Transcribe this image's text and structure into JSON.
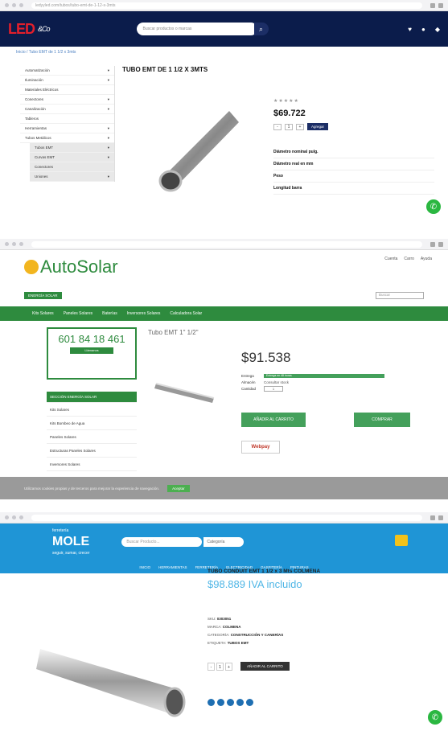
{
  "panel1": {
    "url": "ledyyled.com/tubos/tubo-emt-de-1-12-x-3mts",
    "logo": "LED",
    "logo_sub": "&Co",
    "search_placeholder": "Buscar productos o marcas",
    "breadcrumb": "Inicio / Tubo EMT de 1 1/2 x 3mts",
    "sidebar": [
      "Automatización",
      "Iluminación",
      "Materiales Eléctricos",
      "Conectores",
      "Canalización",
      "Tableros",
      "Herramientas",
      "Tubos Metálicos"
    ],
    "sidebar_sub": [
      "Tubos EMT",
      "Curvas EMT",
      "Conectores",
      "Uniones"
    ],
    "title": "TUBO EMT DE 1 1/2 X 3MTS",
    "stars": "★★★★★",
    "price": "$69.722",
    "add_label": "Agregar",
    "specs": [
      "Diámetro nominal pulg.",
      "Diámetro real en mm",
      "Peso",
      "Longitud barra"
    ]
  },
  "panel2": {
    "logo": "AutoSolar",
    "badge": "ENERGÍA SOLAR",
    "top_links": [
      "Cuenta",
      "Carro",
      "Ayuda"
    ],
    "search_placeholder": "Buscar",
    "nav": [
      "Kits Solares",
      "Paneles Solares",
      "Baterías",
      "Inversores Solares",
      "Calculadora Solar"
    ],
    "phone": "601 84 18 461",
    "phone_button": "Llámanos",
    "menu_head": "SECCIÓN ENERGÍA SOLAR",
    "menu": [
      "Kits Solares",
      "Kits Bombeo de Agua",
      "Paneles Solares",
      "Estructuras Paneles Solares",
      "Inversores Solares"
    ],
    "title": "Tubo EMT 1\" 1/2\"",
    "price": "$91.538",
    "rows": [
      [
        "Entrega",
        "Entrega en 48 horas"
      ],
      [
        "Almacén",
        "Consultar stock"
      ],
      [
        "Cantidad",
        "1"
      ]
    ],
    "buy_button": "AÑADIR AL CARRITO",
    "buy_now": "COMPRAR",
    "webpay": "Webpay",
    "cookie_text": "Utilizamos cookies propias y de terceros para mejorar la experiencia de navegación.",
    "cookie_accept": "Aceptar"
  },
  "panel3": {
    "logo": "MOLE",
    "logo_top": "ferretería",
    "logo_sub": "seguir, sumar, crecer",
    "search_placeholder": "Buscar Producto...",
    "category": "Categoría",
    "nav": [
      "INICIO",
      "HERRAMIENTAS",
      "FERRETERÍA",
      "ELECTRICIDAD",
      "GASFITERÍA",
      "PINTURAS"
    ],
    "title": "TUBO CONDUIT EMT 1 1/2 x 3 Mts COLMENA",
    "price": "$98.889 IVA incluido",
    "meta": [
      [
        "SKU:",
        "0303051"
      ],
      [
        "MARCA:",
        "COLMENA"
      ],
      [
        "CATEGORÍA:",
        "CONSTRUCCIÓN Y CANERÍAS"
      ],
      [
        "ETIQUETA:",
        "TUBOS EMT"
      ]
    ],
    "qty": "1",
    "add_button": "AÑADIR AL CARRITO"
  }
}
